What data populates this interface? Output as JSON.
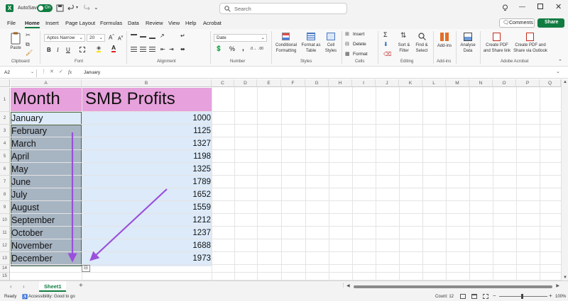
{
  "titlebar": {
    "autosave_label": "AutoSave",
    "autosave_state": "On",
    "search_placeholder": "Search"
  },
  "menu": [
    "File",
    "Home",
    "Insert",
    "Page Layout",
    "Formulas",
    "Data",
    "Review",
    "View",
    "Help",
    "Acrobat"
  ],
  "actions": {
    "comments": "Comments",
    "share": "Share"
  },
  "ribbon": {
    "paste": "Paste",
    "font_name": "Aptos Narrow",
    "font_size": "20",
    "number_format": "Date",
    "conditional_formatting": [
      "Conditional",
      "Formatting"
    ],
    "format_as_table": [
      "Format as",
      "Table"
    ],
    "cell_styles": [
      "Cell",
      "Styles"
    ],
    "insert": "Insert",
    "delete": "Delete",
    "format": "Format",
    "sort_filter": [
      "Sort &",
      "Filter"
    ],
    "find_select": [
      "Find &",
      "Select"
    ],
    "add_ins": "Add-ins",
    "analyse_data": [
      "Analyse",
      "Data"
    ],
    "create_pdf_link": [
      "Create PDF",
      "and Share link"
    ],
    "create_pdf_outlook": [
      "Create PDF and",
      "Share via Outlook"
    ],
    "groups": {
      "clipboard": "Clipboard",
      "font": "Font",
      "alignment": "Alignment",
      "number": "Number",
      "styles": "Styles",
      "cells": "Cells",
      "editing": "Editing",
      "addins": "Add-ins",
      "acrobat": "Adobe Acrobat"
    }
  },
  "formula_bar": {
    "name_box": "A2",
    "fx": "fx",
    "content": "January"
  },
  "columns": [
    "A",
    "B",
    "C",
    "D",
    "E",
    "F",
    "G",
    "H",
    "I",
    "J",
    "K",
    "L",
    "M",
    "N",
    "O",
    "P",
    "Q"
  ],
  "rows": [
    "1",
    "2",
    "3",
    "4",
    "5",
    "6",
    "7",
    "8",
    "9",
    "10",
    "11",
    "12",
    "13",
    "14",
    "15"
  ],
  "headers": {
    "month": "Month",
    "profits": "SMB Profits"
  },
  "table": [
    {
      "month": "January",
      "profit": "1000"
    },
    {
      "month": "February",
      "profit": "1125"
    },
    {
      "month": "March",
      "profit": "1327"
    },
    {
      "month": "April",
      "profit": "1198"
    },
    {
      "month": "May",
      "profit": "1325"
    },
    {
      "month": "June",
      "profit": "1789"
    },
    {
      "month": "July",
      "profit": "1652"
    },
    {
      "month": "August",
      "profit": "1559"
    },
    {
      "month": "September",
      "profit": "1212"
    },
    {
      "month": "October",
      "profit": "1237"
    },
    {
      "month": "November",
      "profit": "1688"
    },
    {
      "month": "December",
      "profit": "1973"
    }
  ],
  "sheet_tab": "Sheet1",
  "status": {
    "ready": "Ready",
    "accessibility": "Accessibility: Good to go",
    "count": "Count: 12",
    "zoom": "100%"
  },
  "colors": {
    "excel_green": "#107c41",
    "header_fill": "#e7a1dc",
    "data_fill": "#dceaf9",
    "selection_fill": "#a7b4c2",
    "arrow": "#9a4fdc"
  }
}
